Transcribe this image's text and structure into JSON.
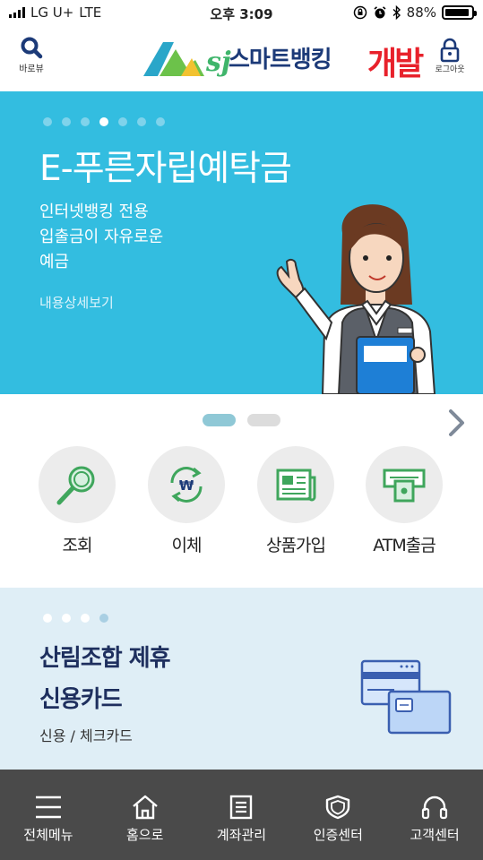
{
  "status_bar": {
    "carrier": "LG U+",
    "network": "LTE",
    "time": "오후 3:09",
    "battery": "88%",
    "battery_level": 0.88
  },
  "header": {
    "search_label": "바로뷰",
    "app_name": "스마트뱅킹",
    "env_label": "개발",
    "logout_label": "로그아웃",
    "brand_colors": {
      "navy": "#1c3a78",
      "green": "#3fb56b",
      "red": "#e8212b"
    }
  },
  "banner": {
    "title": "E-푸른자립예탁금",
    "desc_lines": [
      "인터넷뱅킹 전용",
      "입출금이 자유로운",
      "예금"
    ],
    "link": "내용상세보기",
    "slide_count": 7,
    "active_slide": 4,
    "bg_color": "#33bde0"
  },
  "pager": {
    "pages": 2,
    "active": 1
  },
  "quick_menu": [
    {
      "label": "조회",
      "icon": "magnifier-icon"
    },
    {
      "label": "이체",
      "icon": "won-transfer-icon"
    },
    {
      "label": "상품가입",
      "icon": "newspaper-icon"
    },
    {
      "label": "ATM출금",
      "icon": "atm-icon"
    }
  ],
  "promo": {
    "title_lines": [
      "산림조합 제휴",
      "신용카드"
    ],
    "subtitle": "신용 / 체크카드",
    "slide_count": 4,
    "active_slide": 4
  },
  "bottom_nav": [
    {
      "label": "전체메뉴",
      "icon": "hamburger-icon"
    },
    {
      "label": "홈으로",
      "icon": "home-icon"
    },
    {
      "label": "계좌관리",
      "icon": "document-icon"
    },
    {
      "label": "인증센터",
      "icon": "shield-icon"
    },
    {
      "label": "고객센터",
      "icon": "headset-icon"
    }
  ]
}
